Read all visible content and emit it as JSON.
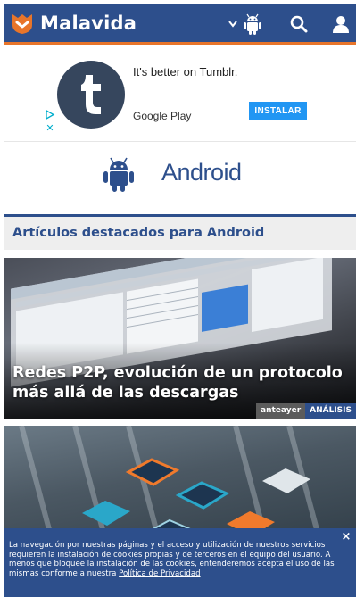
{
  "header": {
    "brand": "Malavida",
    "icons": [
      "malavida-logo-icon",
      "chevron-down-icon",
      "android-icon",
      "search-icon",
      "user-icon"
    ],
    "colors": {
      "bar": "#2d4f8c",
      "accent": "#e8752a"
    }
  },
  "ad": {
    "headline": "It's better on Tumblr.",
    "store": "Google Play",
    "install_label": "INSTALAR",
    "icon": "tumblr-t-icon",
    "close_glyph": "✕"
  },
  "platform": {
    "title": "Android",
    "icon": "android-icon"
  },
  "section": {
    "title": "Artículos destacados para Android"
  },
  "articles": [
    {
      "title": "Redes P2P, evolución de un protocolo más allá de las descargas",
      "date": "anteayer",
      "type": "ANÁLISIS"
    },
    {
      "title": "",
      "date": "",
      "type": ""
    }
  ],
  "cookie": {
    "text": "La navegación por nuestras páginas y el acceso y utilización de nuestros servicios requieren la instalación de cookies propias y de terceros en el equipo del usuario. A menos que bloquee la instalación de las cookies, entenderemos acepta el uso de las mismas conforme a nuestra",
    "link": "Política de Privacidad",
    "close_glyph": "×"
  }
}
